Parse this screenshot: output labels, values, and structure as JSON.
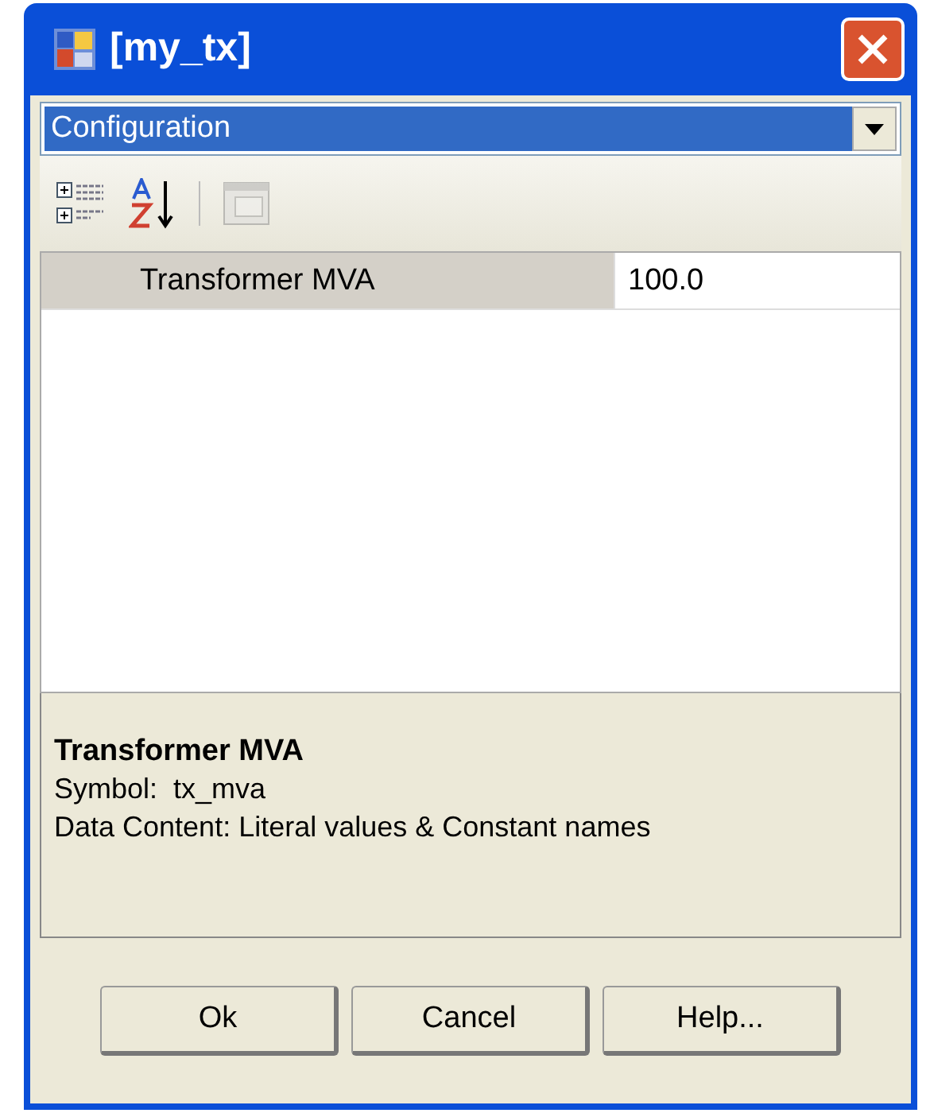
{
  "window": {
    "title": "[my_tx]"
  },
  "category_dropdown": {
    "value": "Configuration"
  },
  "properties": [
    {
      "name": "Transformer MVA",
      "value": "100.0",
      "selected": true
    }
  ],
  "description": {
    "title": "Transformer MVA",
    "lines": [
      "Symbol:  tx_mva",
      "Data Content: Literal values & Constant names"
    ]
  },
  "buttons": [
    "Ok",
    "Cancel",
    "Help..."
  ]
}
